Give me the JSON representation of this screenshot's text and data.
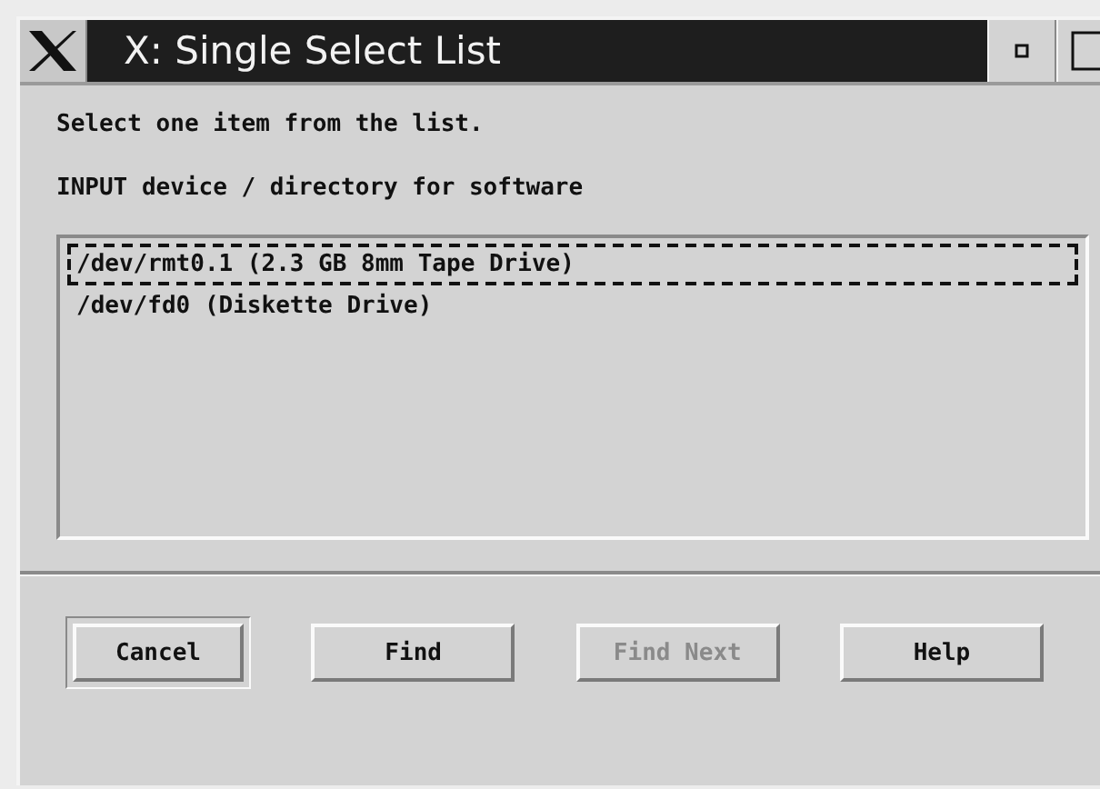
{
  "window": {
    "title": "X: Single Select List"
  },
  "instruction": "Select one item from the list.",
  "prompt": "INPUT device / directory for software",
  "list": {
    "items": [
      {
        "label": "/dev/rmt0.1 (2.3 GB 8mm Tape Drive)",
        "focused": true
      },
      {
        "label": "/dev/fd0 (Diskette Drive)",
        "focused": false
      }
    ]
  },
  "buttons": [
    {
      "label": "Cancel",
      "default": true,
      "disabled": false
    },
    {
      "label": "Find",
      "default": false,
      "disabled": false
    },
    {
      "label": "Find Next",
      "default": false,
      "disabled": true
    },
    {
      "label": "Help",
      "default": false,
      "disabled": false
    }
  ]
}
